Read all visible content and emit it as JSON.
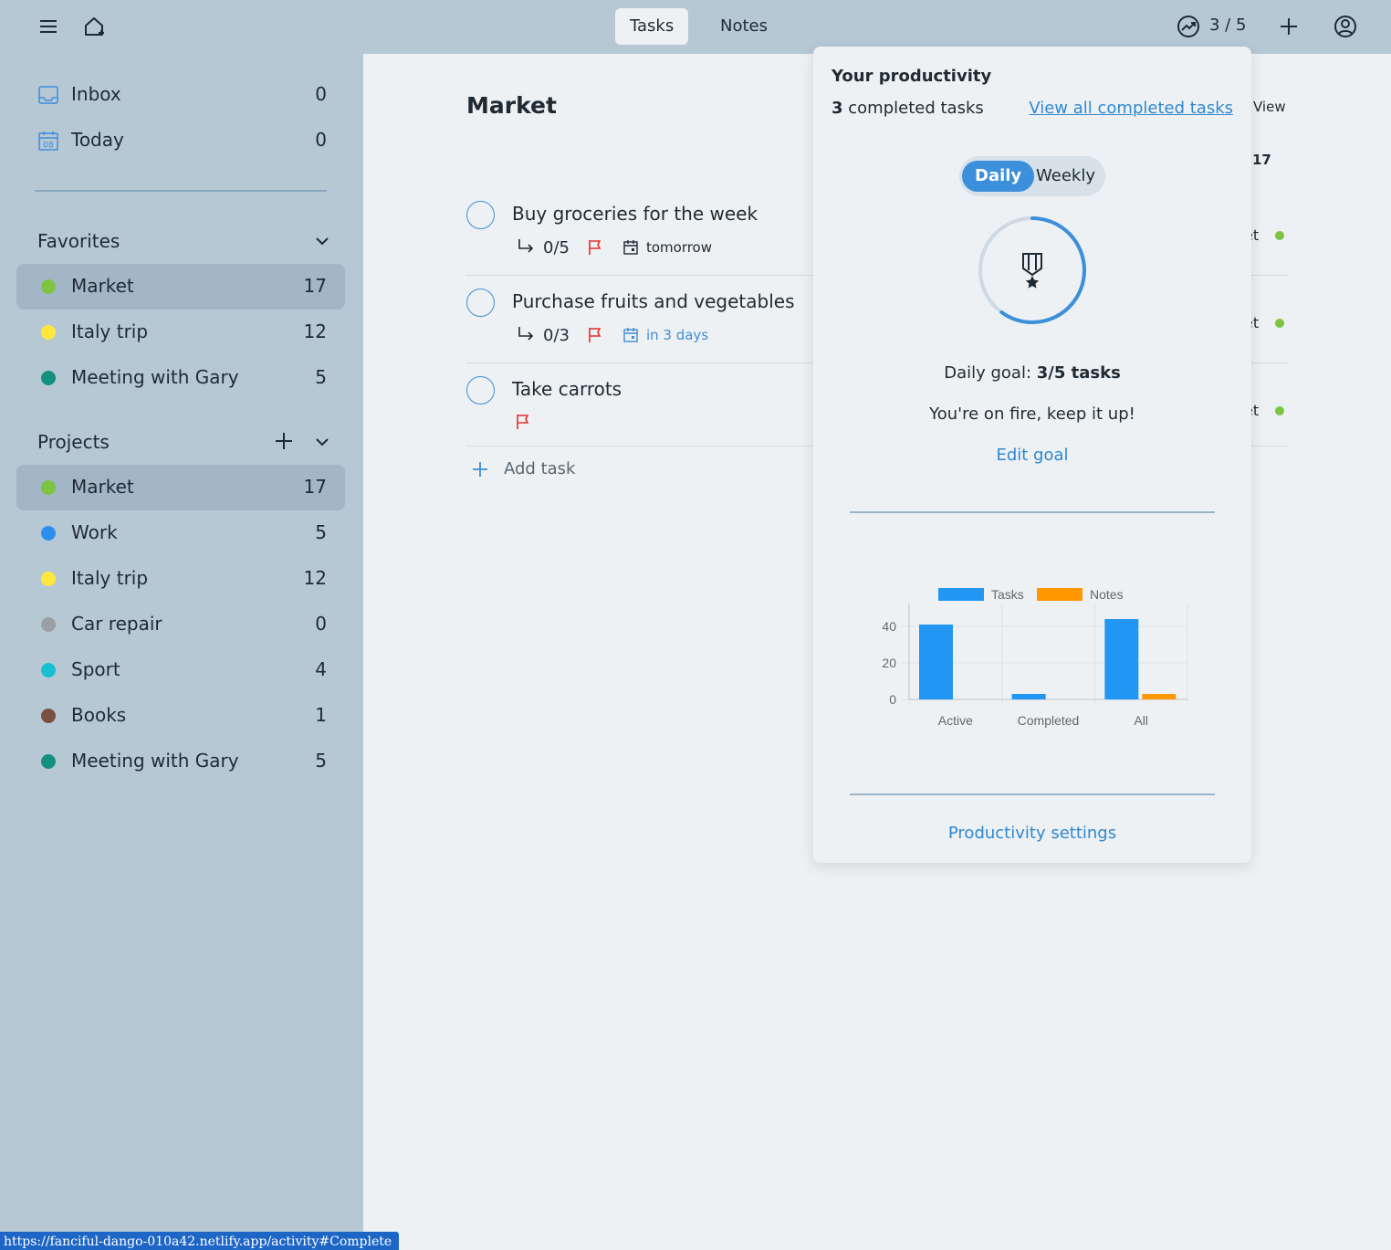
{
  "topbar": {
    "tabs": [
      {
        "label": "Tasks",
        "active": true
      },
      {
        "label": "Notes",
        "active": false
      }
    ],
    "productivity_count": "3 / 5"
  },
  "sidebar": {
    "inbox": {
      "label": "Inbox",
      "count": "0"
    },
    "today": {
      "label": "Today",
      "count": "0",
      "date_badge": "08"
    },
    "favorites_title": "Favorites",
    "favorites": [
      {
        "label": "Market",
        "count": "17",
        "color": "#7cc441",
        "selected": true
      },
      {
        "label": "Italy trip",
        "count": "12",
        "color": "#ffe83b"
      },
      {
        "label": "Meeting with Gary",
        "count": "5",
        "color": "#15907f"
      }
    ],
    "projects_title": "Projects",
    "projects": [
      {
        "label": "Market",
        "count": "17",
        "color": "#7cc441",
        "selected": true
      },
      {
        "label": "Work",
        "count": "5",
        "color": "#2c8ff0"
      },
      {
        "label": "Italy trip",
        "count": "12",
        "color": "#ffe83b"
      },
      {
        "label": "Car repair",
        "count": "0",
        "color": "#9aa0a4"
      },
      {
        "label": "Sport",
        "count": "4",
        "color": "#19bfd2"
      },
      {
        "label": "Books",
        "count": "1",
        "color": "#7a5044"
      },
      {
        "label": "Meeting with Gary",
        "count": "5",
        "color": "#15907f"
      }
    ]
  },
  "main": {
    "title": "Market",
    "view_label": "View",
    "all_count": "17",
    "tasks": [
      {
        "title": "Buy groceries for the week",
        "subtasks": "0/5",
        "date": "tomorrow",
        "project": "et"
      },
      {
        "title": "Purchase fruits and vegetables",
        "subtasks": "0/3",
        "date": "in 3 days",
        "project": "et"
      },
      {
        "title": "Take carrots",
        "subtasks": "",
        "date": "",
        "project": "et"
      }
    ],
    "add_task": "Add task"
  },
  "popover": {
    "title": "Your productivity",
    "completed_num": "3",
    "completed_text": "completed tasks",
    "view_all": "View all completed tasks",
    "seg_daily": "Daily",
    "seg_weekly": "Weekly",
    "goal_prefix": "Daily goal:",
    "goal_value": "3/5 tasks",
    "goal_progress": 0.6,
    "fire_msg": "You're on fire, keep it up!",
    "edit_goal": "Edit goal",
    "settings": "Productivity settings"
  },
  "chart_data": {
    "type": "bar",
    "categories": [
      "Active",
      "Completed",
      "All"
    ],
    "series": [
      {
        "name": "Tasks",
        "values": [
          41,
          3,
          44
        ],
        "color": "#2196f3"
      },
      {
        "name": "Notes",
        "values": [
          0,
          0,
          3
        ],
        "color": "#ff9800"
      }
    ],
    "y_ticks": [
      0,
      20,
      40
    ],
    "ylim": [
      0,
      50
    ],
    "legend": "top",
    "grid": true
  },
  "status_url": "https://fanciful-dango-010a42.netlify.app/activity#Complete"
}
